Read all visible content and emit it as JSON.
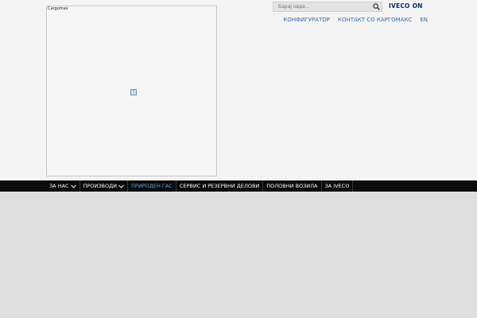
{
  "logo": {
    "alt_text": "Cargomax"
  },
  "search": {
    "placeholder": "Барај овде..."
  },
  "brand": {
    "name": "IVECO",
    "suffix": "ON"
  },
  "top_links": [
    {
      "label": "КОНФИГУРАТОР"
    },
    {
      "label": "КОНТАКТ СО КАРГОМАКС"
    },
    {
      "label": "EN"
    }
  ],
  "nav": {
    "items": [
      {
        "label": "ЗА НАС",
        "has_dropdown": true
      },
      {
        "label": "ПРОИЗВОДИ",
        "has_dropdown": true
      },
      {
        "label": "ПРИРОДЕН ГАС",
        "active": true
      },
      {
        "label": "СЕРВИС И РЕЗЕРВНИ ДЕЛОВИ"
      },
      {
        "label": "ПОЛОВНИ ВОЗИЛА"
      },
      {
        "label": "ЗА IVECO"
      }
    ]
  },
  "colors": {
    "nav_background": "#0b0b0b",
    "nav_active": "#5ea1d8",
    "link": "#2b6fb2",
    "brand": "#0b2c5a"
  }
}
